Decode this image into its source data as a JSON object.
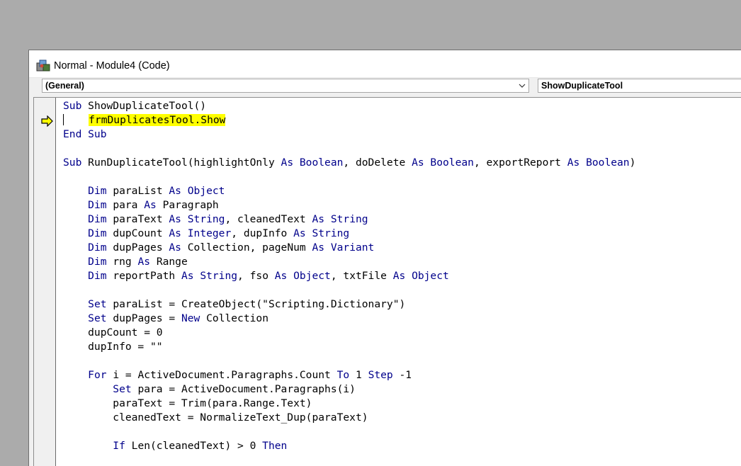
{
  "window": {
    "title": "Normal - Module4 (Code)",
    "icon": "vba-module-icon"
  },
  "toolbar": {
    "object_combo": "(General)",
    "procedure_combo": "ShowDuplicateTool"
  },
  "colors": {
    "keyword": "#00008b",
    "highlight": "#ffff00",
    "execution_arrow": "#ffff00"
  },
  "code_lines": [
    [
      {
        "t": "Sub ",
        "k": true
      },
      {
        "t": "ShowDuplicateTool()"
      }
    ],
    [
      {
        "t": "    "
      },
      {
        "t": "frmDuplicatesTool.Show",
        "h": true
      }
    ],
    [
      {
        "t": "End Sub",
        "k": true
      }
    ],
    [],
    [
      {
        "t": "Sub ",
        "k": true
      },
      {
        "t": "RunDuplicateTool(highlightOnly "
      },
      {
        "t": "As Boolean",
        "k": true
      },
      {
        "t": ", doDelete "
      },
      {
        "t": "As Boolean",
        "k": true
      },
      {
        "t": ", exportReport "
      },
      {
        "t": "As Boolean",
        "k": true
      },
      {
        "t": ")"
      }
    ],
    [],
    [
      {
        "t": "    "
      },
      {
        "t": "Dim ",
        "k": true
      },
      {
        "t": "paraList "
      },
      {
        "t": "As Object",
        "k": true
      }
    ],
    [
      {
        "t": "    "
      },
      {
        "t": "Dim ",
        "k": true
      },
      {
        "t": "para "
      },
      {
        "t": "As ",
        "k": true
      },
      {
        "t": "Paragraph"
      }
    ],
    [
      {
        "t": "    "
      },
      {
        "t": "Dim ",
        "k": true
      },
      {
        "t": "paraText "
      },
      {
        "t": "As String",
        "k": true
      },
      {
        "t": ", cleanedText "
      },
      {
        "t": "As String",
        "k": true
      }
    ],
    [
      {
        "t": "    "
      },
      {
        "t": "Dim ",
        "k": true
      },
      {
        "t": "dupCount "
      },
      {
        "t": "As Integer",
        "k": true
      },
      {
        "t": ", dupInfo "
      },
      {
        "t": "As String",
        "k": true
      }
    ],
    [
      {
        "t": "    "
      },
      {
        "t": "Dim ",
        "k": true
      },
      {
        "t": "dupPages "
      },
      {
        "t": "As ",
        "k": true
      },
      {
        "t": "Collection, pageNum "
      },
      {
        "t": "As Variant",
        "k": true
      }
    ],
    [
      {
        "t": "    "
      },
      {
        "t": "Dim ",
        "k": true
      },
      {
        "t": "rng "
      },
      {
        "t": "As ",
        "k": true
      },
      {
        "t": "Range"
      }
    ],
    [
      {
        "t": "    "
      },
      {
        "t": "Dim ",
        "k": true
      },
      {
        "t": "reportPath "
      },
      {
        "t": "As String",
        "k": true
      },
      {
        "t": ", fso "
      },
      {
        "t": "As Object",
        "k": true
      },
      {
        "t": ", txtFile "
      },
      {
        "t": "As Object",
        "k": true
      }
    ],
    [],
    [
      {
        "t": "    "
      },
      {
        "t": "Set ",
        "k": true
      },
      {
        "t": "paraList = CreateObject(\"Scripting.Dictionary\")"
      }
    ],
    [
      {
        "t": "    "
      },
      {
        "t": "Set ",
        "k": true
      },
      {
        "t": "dupPages = "
      },
      {
        "t": "New ",
        "k": true
      },
      {
        "t": "Collection"
      }
    ],
    [
      {
        "t": "    dupCount = 0"
      }
    ],
    [
      {
        "t": "    dupInfo = \"\""
      }
    ],
    [],
    [
      {
        "t": "    "
      },
      {
        "t": "For ",
        "k": true
      },
      {
        "t": "i = ActiveDocument.Paragraphs.Count "
      },
      {
        "t": "To ",
        "k": true
      },
      {
        "t": "1 "
      },
      {
        "t": "Step ",
        "k": true
      },
      {
        "t": "-1"
      }
    ],
    [
      {
        "t": "        "
      },
      {
        "t": "Set ",
        "k": true
      },
      {
        "t": "para = ActiveDocument.Paragraphs(i)"
      }
    ],
    [
      {
        "t": "        paraText = Trim(para.Range.Text)"
      }
    ],
    [
      {
        "t": "        cleanedText = NormalizeText_Dup(paraText)"
      }
    ],
    [],
    [
      {
        "t": "        "
      },
      {
        "t": "If ",
        "k": true
      },
      {
        "t": "Len(cleanedText) > 0 "
      },
      {
        "t": "Then",
        "k": true
      }
    ]
  ]
}
